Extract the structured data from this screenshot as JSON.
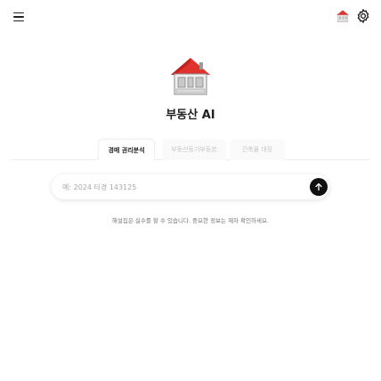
{
  "header": {
    "menu_icon": "menu-icon",
    "logo_icon": "house-logo-icon",
    "settings_icon": "gear-icon"
  },
  "brand": {
    "title": "부동산 AI"
  },
  "tabs": [
    {
      "label": "경매 권리분석",
      "active": true
    },
    {
      "label": "부동산등기부등본",
      "active": false
    },
    {
      "label": "건축물 대장",
      "active": false
    }
  ],
  "search": {
    "placeholder": "예: 2024 타경 143125",
    "value": "",
    "send_icon": "arrow-up-icon"
  },
  "footer": {
    "disclaimer": "해설집은 실수를 할 수 있습니다. 중요한 정보는 재차 확인하세요."
  },
  "colors": {
    "roof": "#e0322f",
    "send_button": "#111111"
  }
}
